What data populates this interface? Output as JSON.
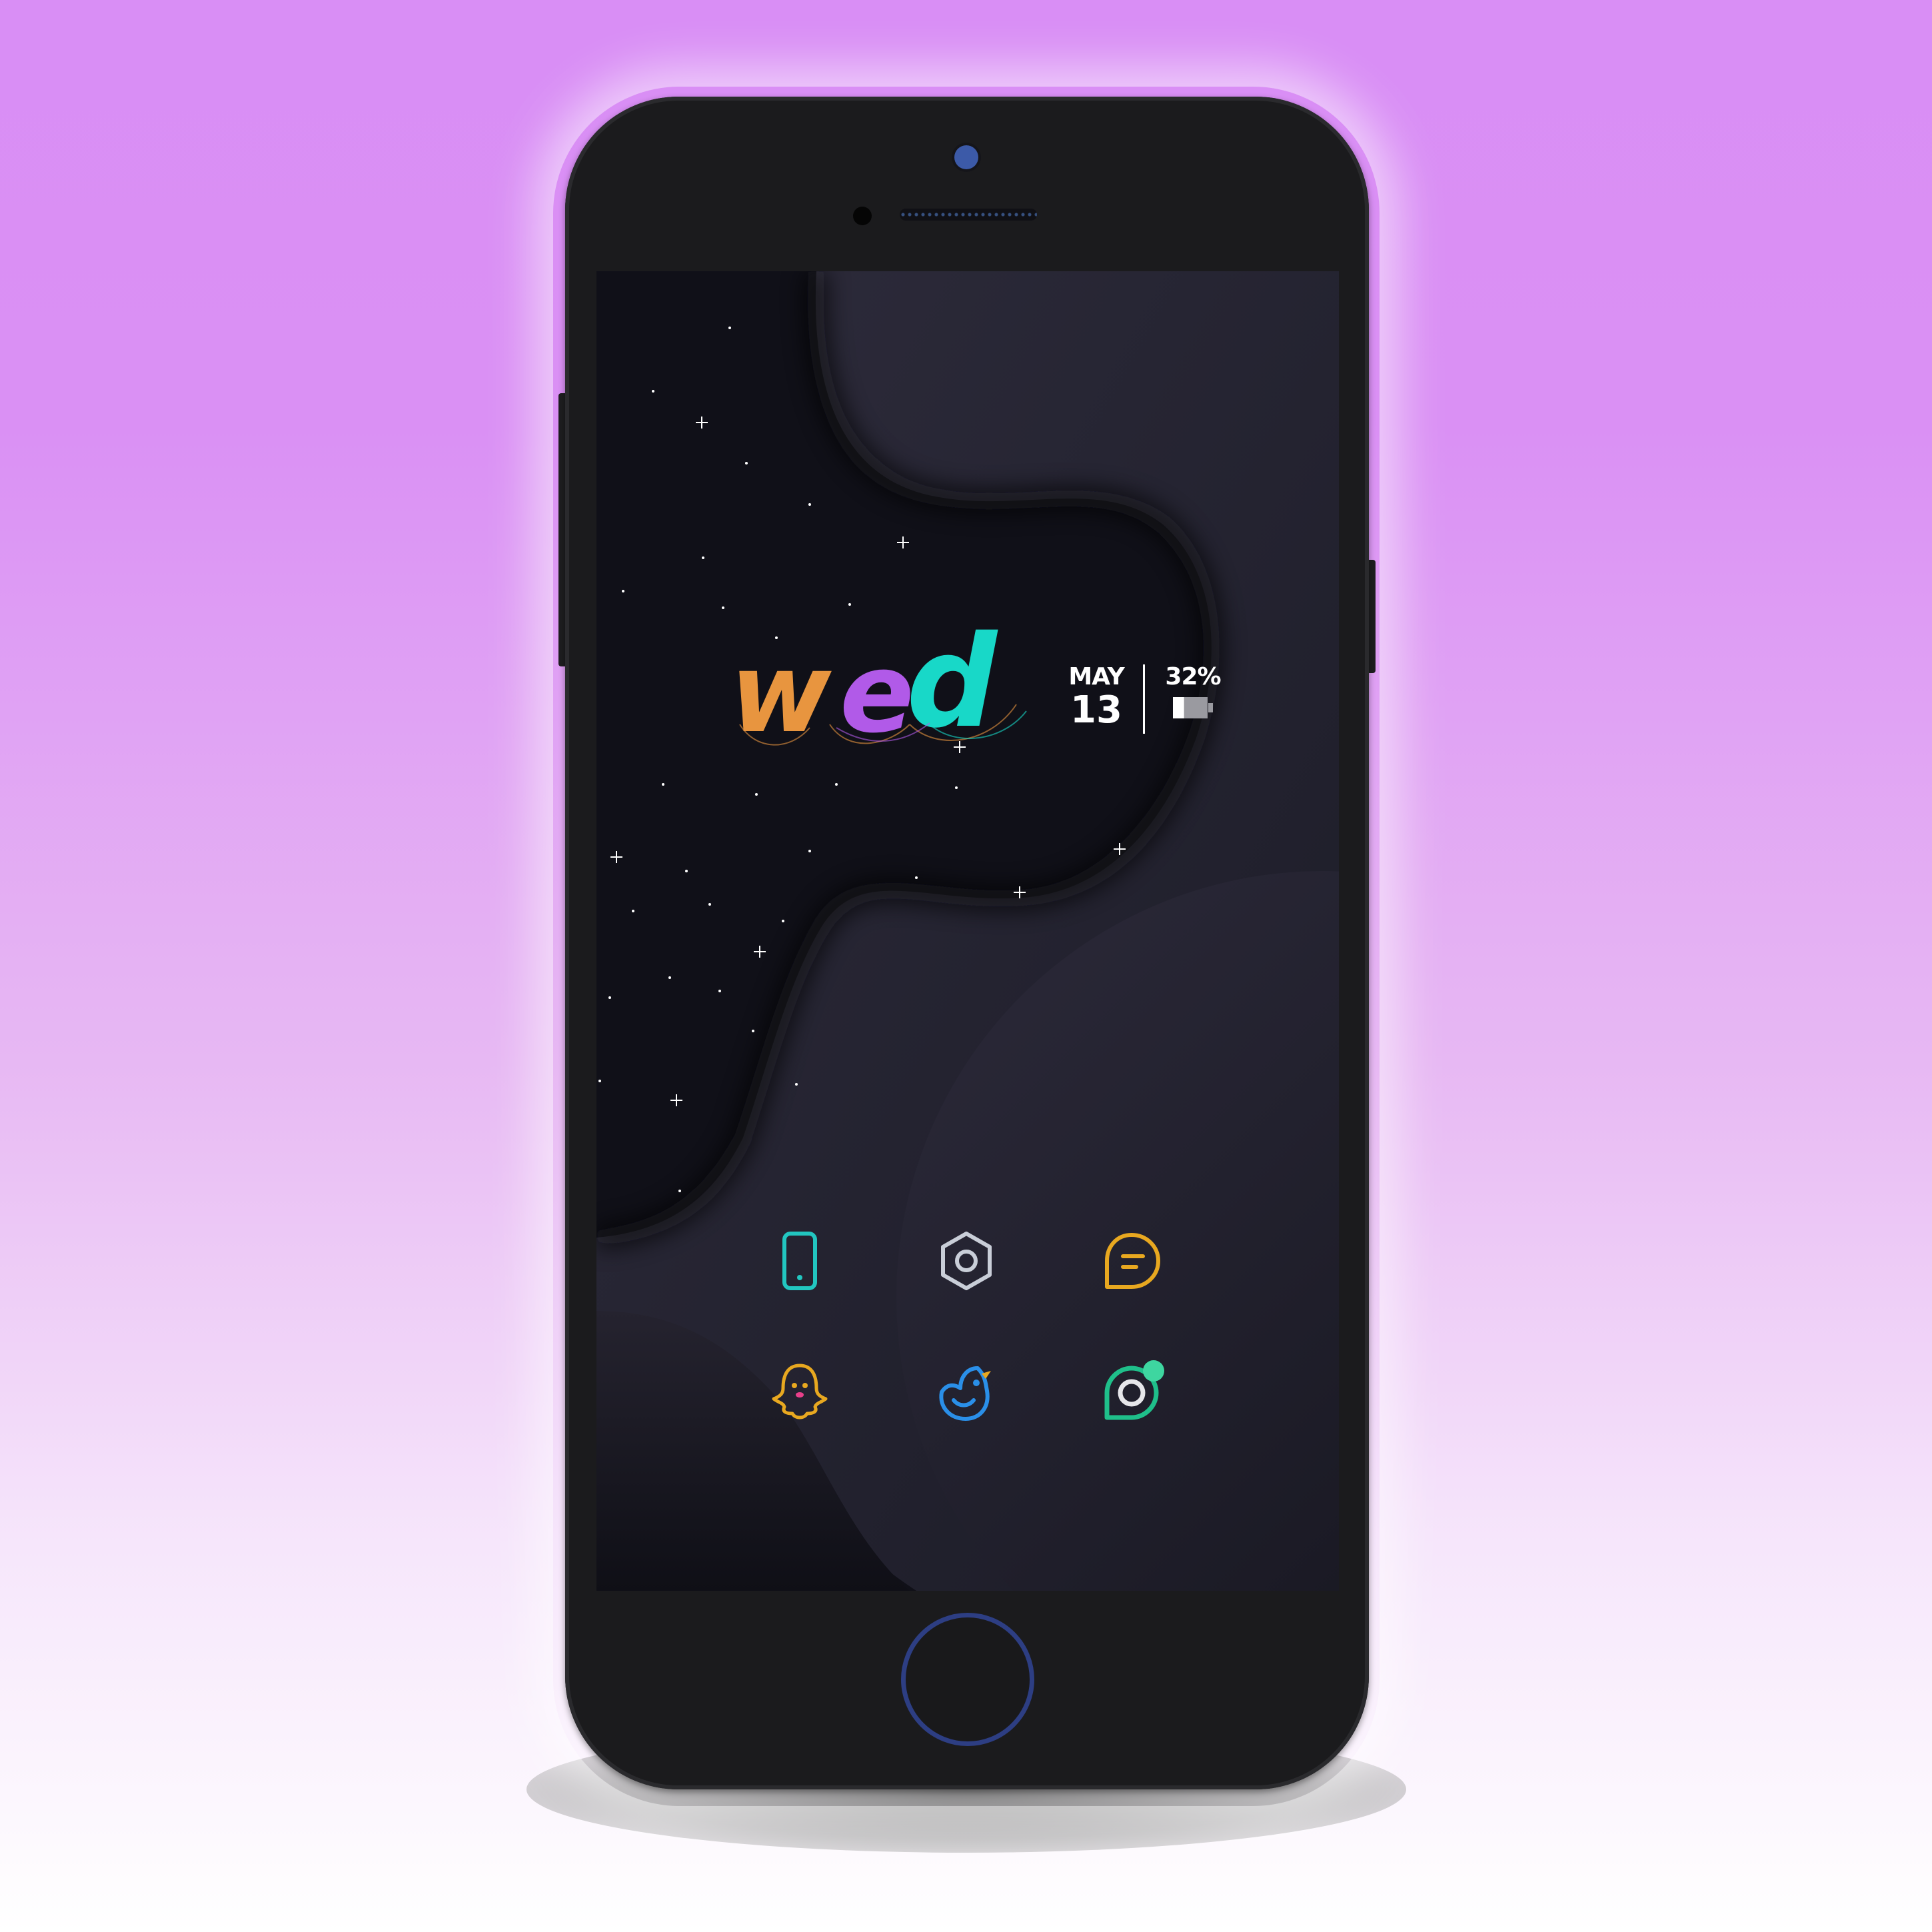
{
  "background": {
    "gradient_top": "#d98ef5",
    "gradient_bottom": "#ffffff"
  },
  "device": {
    "body_color": "#1b1b1d",
    "camera_color": "#3c5aa8",
    "home_button_ring": "#2d3e83"
  },
  "screen": {
    "widget": {
      "day": "wed",
      "day_letter_colors": [
        "#e8953f",
        "#b15ae8",
        "#18d8c8"
      ],
      "month": "MAY",
      "date": "13",
      "battery_percent": "32%",
      "battery_level": 0.32
    },
    "apps": [
      {
        "name": "phone",
        "icon": "phone-icon",
        "color": "#22c6c0"
      },
      {
        "name": "settings",
        "icon": "settings-gear-icon",
        "color": "#c9ced8"
      },
      {
        "name": "messages",
        "icon": "chat-bubble-icon",
        "color": "#e8a820"
      },
      {
        "name": "snapchat",
        "icon": "ghost-icon",
        "color": "#e8a820"
      },
      {
        "name": "twitter",
        "icon": "bird-icon",
        "color": "#2a8fe8"
      },
      {
        "name": "camera",
        "icon": "camera-lens-icon",
        "color": "#1fbf8a"
      }
    ]
  }
}
